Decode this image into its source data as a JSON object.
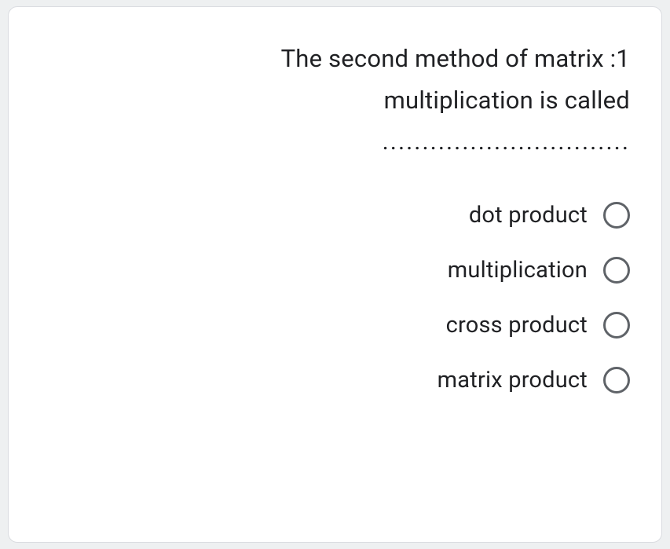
{
  "question": {
    "line1": "The second method of matrix :1",
    "line2": "multiplication is called",
    "dots": "..............................."
  },
  "options": [
    {
      "label": "dot product"
    },
    {
      "label": "multiplication"
    },
    {
      "label": "cross product"
    },
    {
      "label": "matrix product"
    }
  ]
}
